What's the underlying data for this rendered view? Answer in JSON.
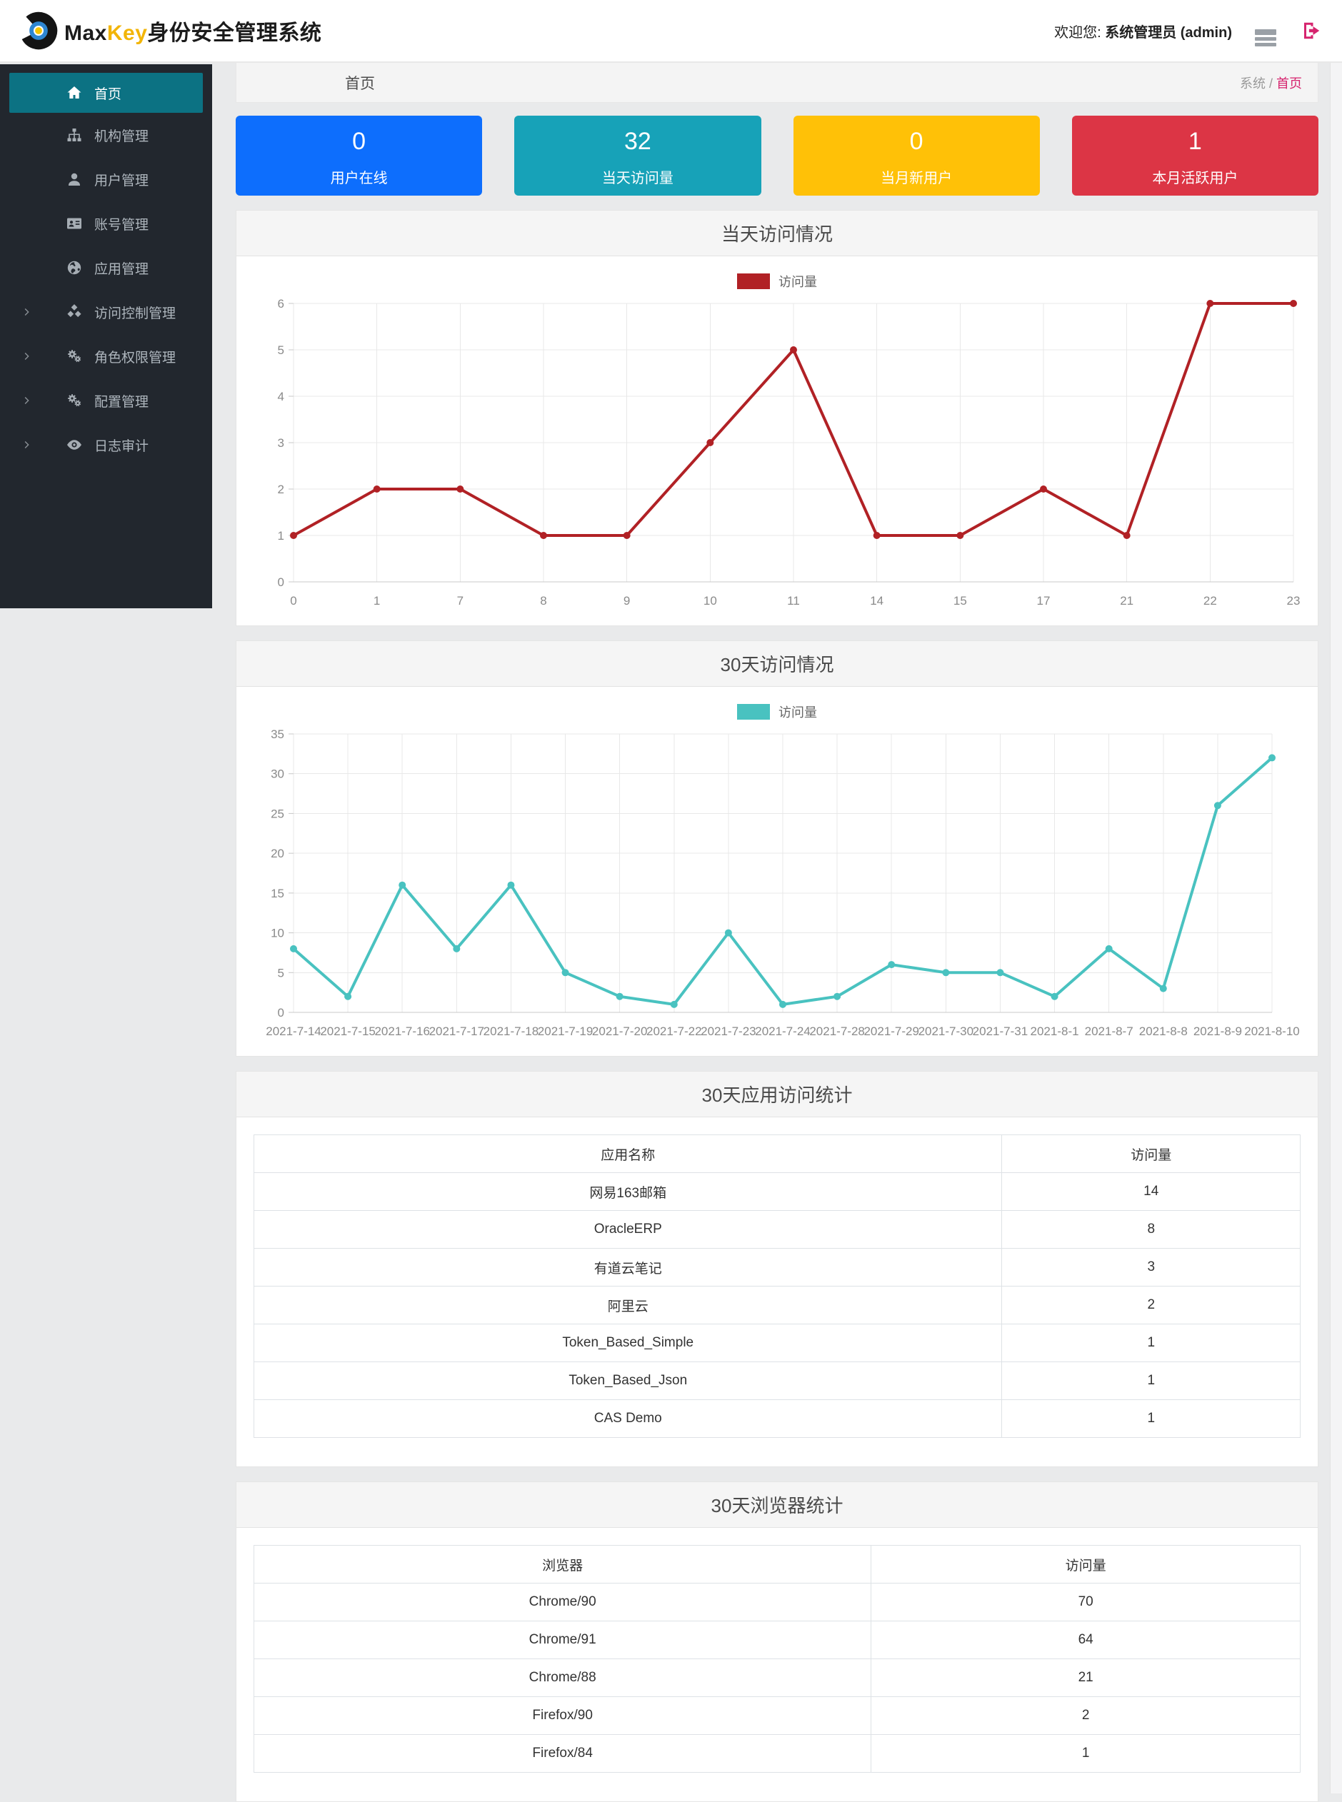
{
  "topbar": {
    "brand": {
      "max": "Max",
      "key": "Key",
      "suffix": "身份安全管理系统"
    },
    "welcome_prefix": "欢迎您:",
    "welcome_user": "系统管理员 (admin)"
  },
  "sidebar": {
    "items": [
      {
        "key": "home",
        "label": "首页",
        "icon": "home-icon",
        "active": true,
        "expandable": false
      },
      {
        "key": "org",
        "label": "机构管理",
        "icon": "sitemap-icon",
        "active": false,
        "expandable": false
      },
      {
        "key": "user",
        "label": "用户管理",
        "icon": "user-icon",
        "active": false,
        "expandable": false
      },
      {
        "key": "account",
        "label": "账号管理",
        "icon": "idcard-icon",
        "active": false,
        "expandable": false
      },
      {
        "key": "app",
        "label": "应用管理",
        "icon": "globe-icon",
        "active": false,
        "expandable": false
      },
      {
        "key": "access-control",
        "label": "访问控制管理",
        "icon": "cubes-icon",
        "active": false,
        "expandable": true
      },
      {
        "key": "role-permission",
        "label": "角色权限管理",
        "icon": "cogs-icon",
        "active": false,
        "expandable": true
      },
      {
        "key": "config",
        "label": "配置管理",
        "icon": "cogs-icon",
        "active": false,
        "expandable": true
      },
      {
        "key": "audit",
        "label": "日志审计",
        "icon": "eye-icon",
        "active": false,
        "expandable": true
      }
    ]
  },
  "breadcrumb": {
    "page_title": "首页",
    "root": "系统",
    "separator": " / ",
    "current": "首页",
    "current_color": "#d6246e"
  },
  "stat_cards": [
    {
      "value": "0",
      "label": "用户在线",
      "color": "#0d6efd"
    },
    {
      "value": "32",
      "label": "当天访问量",
      "color": "#17a2b8"
    },
    {
      "value": "0",
      "label": "当月新用户",
      "color": "#ffc107"
    },
    {
      "value": "1",
      "label": "本月活跃用户",
      "color": "#dc3545"
    }
  ],
  "chart_data": [
    {
      "type": "line",
      "title": "当天访问情况",
      "legend": "访问量",
      "color": "#b12125",
      "categories": [
        "0",
        "1",
        "7",
        "8",
        "9",
        "10",
        "11",
        "14",
        "15",
        "17",
        "21",
        "22",
        "23"
      ],
      "values": [
        1,
        2,
        2,
        1,
        1,
        3,
        5,
        1,
        1,
        2,
        1,
        6,
        6
      ],
      "xlabel": "",
      "ylabel": "",
      "ylim": [
        0,
        6
      ],
      "ytick_step": 1,
      "grid": true,
      "legend_position": "top-center"
    },
    {
      "type": "line",
      "title": "30天访问情况",
      "legend": "访问量",
      "color": "#49c2c0",
      "categories": [
        "2021-7-14",
        "2021-7-15",
        "2021-7-16",
        "2021-7-17",
        "2021-7-18",
        "2021-7-19",
        "2021-7-20",
        "2021-7-22",
        "2021-7-23",
        "2021-7-24",
        "2021-7-28",
        "2021-7-29",
        "2021-7-30",
        "2021-7-31",
        "2021-8-1",
        "2021-8-7",
        "2021-8-8",
        "2021-8-9",
        "2021-8-10"
      ],
      "values": [
        8,
        2,
        16,
        8,
        16,
        5,
        2,
        1,
        10,
        1,
        2,
        6,
        5,
        5,
        2,
        8,
        3,
        26,
        32
      ],
      "xlabel": "",
      "ylabel": "",
      "ylim": [
        0,
        35
      ],
      "ytick_step": 5,
      "grid": true,
      "legend_position": "top-center"
    }
  ],
  "tables": [
    {
      "title": "30天应用访问统计",
      "headers": [
        "应用名称",
        "访问量"
      ],
      "col_widths": [
        "71.5%",
        "28.5%"
      ],
      "rows": [
        [
          "网易163邮箱",
          "14"
        ],
        [
          "OracleERP",
          "8"
        ],
        [
          "有道云笔记",
          "3"
        ],
        [
          "阿里云",
          "2"
        ],
        [
          "Token_Based_Simple",
          "1"
        ],
        [
          "Token_Based_Json",
          "1"
        ],
        [
          "CAS Demo",
          "1"
        ]
      ]
    },
    {
      "title": "30天浏览器统计",
      "headers": [
        "浏览器",
        "访问量"
      ],
      "col_widths": [
        "59%",
        "41%"
      ],
      "rows": [
        [
          "Chrome/90",
          "70"
        ],
        [
          "Chrome/91",
          "64"
        ],
        [
          "Chrome/88",
          "21"
        ],
        [
          "Firefox/90",
          "2"
        ],
        [
          "Firefox/84",
          "1"
        ]
      ]
    }
  ]
}
